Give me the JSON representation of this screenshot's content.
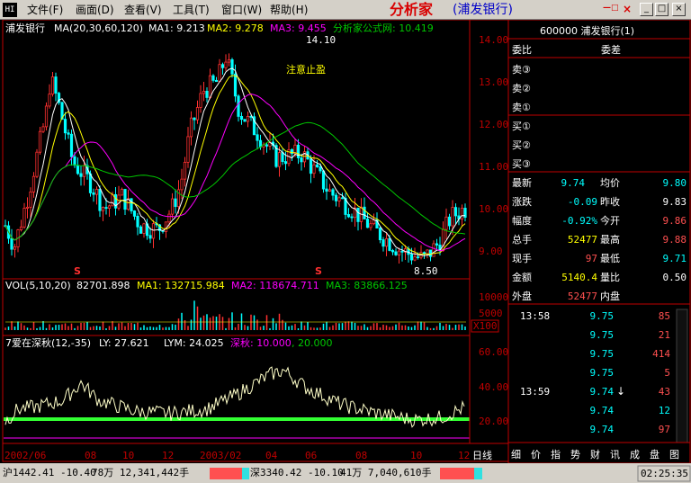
{
  "app": {
    "icon_text": "HI",
    "brand": "分析家",
    "stock_title": "(浦发银行)"
  },
  "menu": [
    {
      "label": "文件(F)",
      "icon": "doc-icon"
    },
    {
      "label": "画面(D)",
      "icon": "screen-icon"
    },
    {
      "label": "查看(V)",
      "icon": "view-icon"
    },
    {
      "label": "工具(T)",
      "icon": "tools-icon"
    },
    {
      "label": "窗口(W)",
      "icon": "window-icon"
    },
    {
      "label": "帮助(H)",
      "icon": "help-icon"
    }
  ],
  "window_buttons": [
    "_",
    "□",
    "×"
  ],
  "main_chart": {
    "stock_name": "浦发银行",
    "ma_title": "MA(20,30,60,120)",
    "ma1": "MA1: 9.213",
    "ma2": "MA2: 9.278",
    "ma3": "MA3: 9.455",
    "formula": "分析家公式网: 10.419",
    "y_ticks": [
      "14.00",
      "13.00",
      "12.00",
      "11.00",
      "10.00",
      "9.00"
    ],
    "high_label": "14.10",
    "low_label": "8.50",
    "annotation": "注意止盈",
    "s_markers": [
      "S",
      "S"
    ],
    "colors": {
      "up": "#ff3030",
      "down": "#00ffff",
      "ma1": "#ffffff",
      "ma2": "#ffff00",
      "ma3": "#ff00ff",
      "ma4": "#00c800"
    }
  },
  "volume": {
    "title": "VOL(5,10,20)",
    "value": "82701.898",
    "ma1": "MA1: 132715.984",
    "ma2": "MA2: 118674.711",
    "ma3": "MA3: 83866.125",
    "y_ticks": [
      "10000",
      "5000"
    ],
    "unit": "X100"
  },
  "indicator": {
    "title": "7爱在深秋(12,-35)",
    "ly": "LY: 27.621",
    "lym": "LYM: 24.025",
    "deep": "深秋: 10.000",
    "level": ", 20.000",
    "y_ticks": [
      "60.00",
      "40.00",
      "20.00",
      "0.00"
    ]
  },
  "xaxis": {
    "labels": [
      "2002/06",
      "08",
      "10",
      "12",
      "2003/02",
      "04",
      "06",
      "08",
      "10",
      "12"
    ],
    "day_label": "日线"
  },
  "quote": {
    "code_name": "600000 浦发银行(1)",
    "header": {
      "left": "委比",
      "right": "委差"
    },
    "sells": [
      "卖③",
      "卖②",
      "卖①"
    ],
    "buys": [
      "买①",
      "买②",
      "买③"
    ],
    "rows": [
      {
        "l1": "最新",
        "v1": "9.74",
        "l2": "均价",
        "v2": "9.80"
      },
      {
        "l1": "涨跌",
        "v1": "-0.09",
        "l2": "昨收",
        "v2": "9.83"
      },
      {
        "l1": "幅度",
        "v1": "-0.92%",
        "l2": "今开",
        "v2": "9.86"
      },
      {
        "l1": "总手",
        "v1": "52477",
        "l2": "最高",
        "v2": "9.88"
      },
      {
        "l1": "现手",
        "v1": "97",
        "l2": "最低",
        "v2": "9.71"
      },
      {
        "l1": "金额",
        "v1": "5140.4",
        "l2": "量比",
        "v2": "0.50"
      },
      {
        "l1": "外盘",
        "v1": "52477",
        "l2": "内盘",
        "v2": ""
      }
    ],
    "ticks": [
      {
        "time": "13:58",
        "price": "9.75",
        "vol": "85"
      },
      {
        "time": "",
        "price": "9.75",
        "vol": "21"
      },
      {
        "time": "",
        "price": "9.75",
        "vol": "414"
      },
      {
        "time": "",
        "price": "9.75",
        "vol": "5"
      },
      {
        "time": "13:59",
        "price": "9.74",
        "vol": "43"
      },
      {
        "time": "",
        "price": "9.74",
        "vol": "12"
      },
      {
        "time": "",
        "price": "9.74",
        "vol": "97"
      }
    ],
    "tabs": [
      "细",
      "价",
      "指",
      "势",
      "财",
      "讯",
      "成",
      "盘",
      "图"
    ]
  },
  "statusbar": {
    "sh": "沪1442.41  -10.40",
    "sh_vol": "78万 12,341,442手",
    "sz": "深3340.42  -10.10",
    "sz_vol": "41万 7,040,610手",
    "time": "02:25:35"
  }
}
